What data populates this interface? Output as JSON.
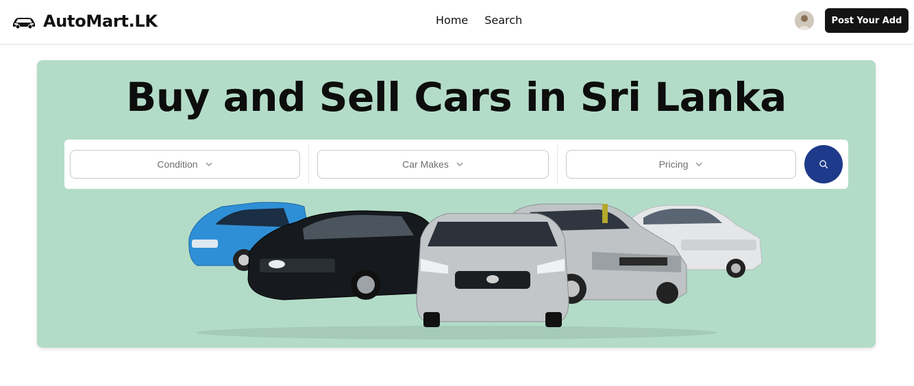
{
  "brand": {
    "name": "AutoMart.LK",
    "icon": "car-icon"
  },
  "nav": {
    "links": [
      {
        "label": "Home"
      },
      {
        "label": "Search"
      }
    ]
  },
  "header": {
    "post_button_label": "Post Your Add",
    "avatar": "user-avatar"
  },
  "hero": {
    "title": "Buy and Sell Cars in Sri Lanka",
    "filters": [
      {
        "label": "Condition",
        "icon": "chevron-down-icon"
      },
      {
        "label": "Car Makes",
        "icon": "chevron-down-icon"
      },
      {
        "label": "Pricing",
        "icon": "chevron-down-icon"
      }
    ],
    "search_button_icon": "search-icon",
    "cars": [
      "blue hatchback",
      "black sedan",
      "silver sedan",
      "silver minivan",
      "white sedan"
    ]
  },
  "colors": {
    "hero_bg": "#b3dcc8",
    "search_button": "#1e3a8a",
    "post_button": "#141414",
    "text": "#111111"
  }
}
